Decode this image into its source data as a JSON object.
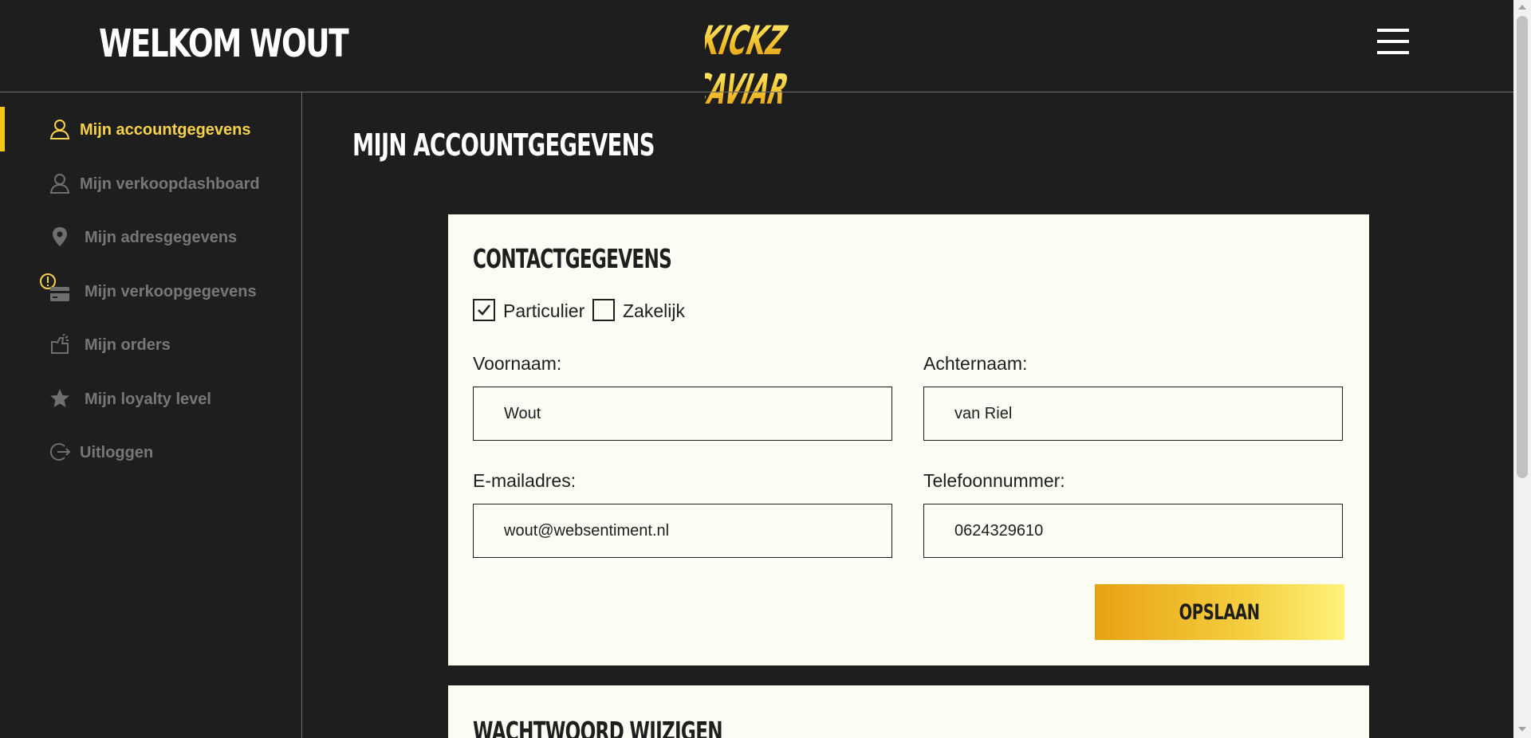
{
  "header": {
    "welcome": "WELKOM WOUT",
    "logo_text": [
      "KICKZ",
      "CAVIAR"
    ],
    "menu_icon": "hamburger-icon"
  },
  "sidebar": {
    "items": [
      {
        "label": "Mijn accountgegevens",
        "icon": "user-icon",
        "active": true
      },
      {
        "label": "Mijn verkoopdashboard",
        "icon": "user-icon"
      },
      {
        "label": "Mijn adresgegevens",
        "icon": "map-pin-icon"
      },
      {
        "label": "Mijn verkoopgegevens",
        "icon": "credit-card-icon",
        "badge_icon": "warning-icon"
      },
      {
        "label": "Mijn orders",
        "icon": "shopping-bag-icon"
      },
      {
        "label": "Mijn loyalty level",
        "icon": "star-icon"
      },
      {
        "label": "Uitloggen",
        "icon": "logout-icon"
      }
    ]
  },
  "main": {
    "title": "MIJN ACCOUNTGEGEVENS",
    "contact": {
      "title": "CONTACTGEGEVENS",
      "type_particulier": {
        "label": "Particulier",
        "checked": true
      },
      "type_zakelijk": {
        "label": "Zakelijk",
        "checked": false
      },
      "first_name": {
        "label": "Voornaam:",
        "value": "Wout"
      },
      "last_name": {
        "label": "Achternaam:",
        "value": "van Riel"
      },
      "email": {
        "label": "E-mailadres:",
        "value": "wout@websentiment.nl"
      },
      "phone": {
        "label": "Telefoonnummer:",
        "value": "0624329610"
      },
      "save_label": "OPSLAAN"
    },
    "password": {
      "title": "WACHTWOORD WIJZIGEN"
    }
  },
  "colors": {
    "background": "#1e1e1e",
    "accent": "#f6d24a",
    "card": "#fcfbf4",
    "muted": "#777777"
  }
}
